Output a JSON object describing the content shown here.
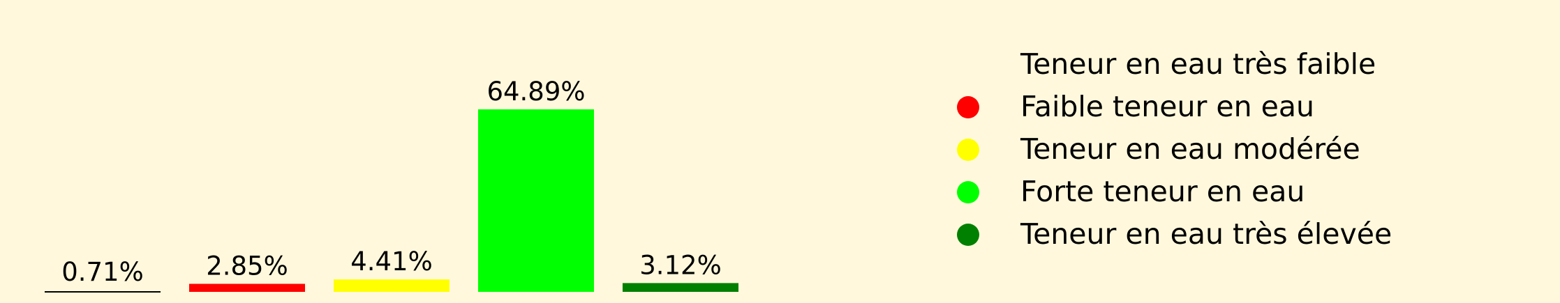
{
  "chart_data": {
    "type": "bar",
    "categories": [
      "Teneur en eau très faible",
      "Faible teneur en eau",
      "Teneur en eau modérée",
      "Forte teneur en eau",
      "Teneur en eau très élevée"
    ],
    "values": [
      0.71,
      2.85,
      4.41,
      64.89,
      3.12
    ],
    "value_labels": [
      "0.71%",
      "2.85%",
      "4.41%",
      "64.89%",
      "3.12%"
    ],
    "colors": [
      "#FFF8DC",
      "#FF0000",
      "#FFFF00",
      "#00FF00",
      "#008000"
    ],
    "ylim": [
      0,
      64.89
    ],
    "grid": false,
    "legend_position": "right",
    "legend": [
      {
        "label": "Teneur en eau très faible",
        "color": "#FFF8DC"
      },
      {
        "label": "Faible teneur en eau",
        "color": "#FF0000"
      },
      {
        "label": "Teneur en eau modérée",
        "color": "#FFFF00"
      },
      {
        "label": "Forte teneur en eau",
        "color": "#00FF00"
      },
      {
        "label": "Teneur en eau très élevée",
        "color": "#008000"
      }
    ]
  }
}
